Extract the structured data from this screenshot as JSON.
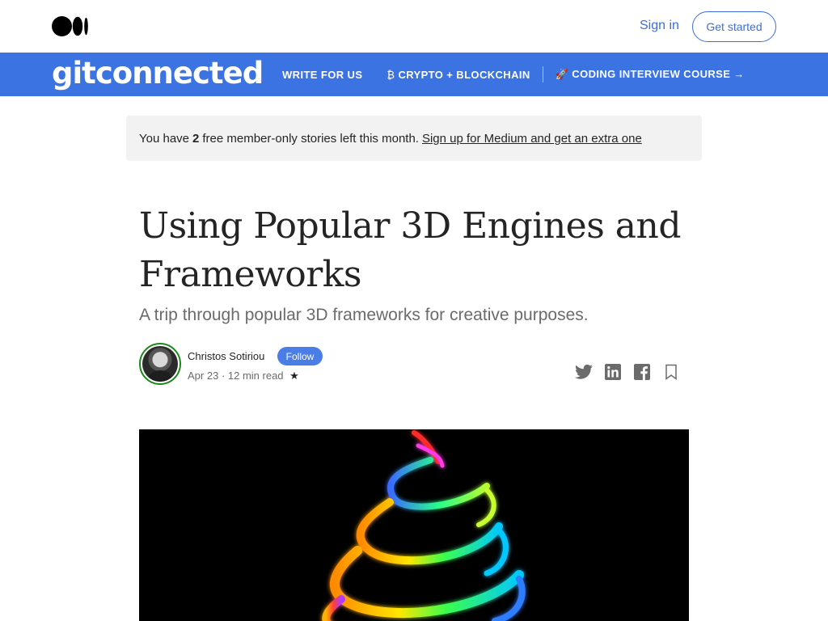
{
  "topbar": {
    "logo_icon": "medium-logo",
    "sign_in": "Sign in",
    "get_started": "Get started"
  },
  "publication": {
    "name": "gitconnected",
    "nav": [
      {
        "icon": "",
        "label": "WRITE FOR US"
      },
      {
        "icon": "₿",
        "label": "CRYPTO + BLOCKCHAIN"
      },
      {
        "icon": "🚀",
        "label": "CODING INTERVIEW COURSE →"
      }
    ],
    "accent": "#3b73e2"
  },
  "banner": {
    "prefix": "You have",
    "count": "2",
    "suffix": "free member-only stories left this month.",
    "signup": "Sign up for Medium and get an extra one"
  },
  "article": {
    "title": "Using Popular 3D Engines and Frameworks",
    "subtitle": "A trip through popular 3D frameworks for creative purposes.",
    "author": "Christos Sotiriou",
    "follow": "Follow",
    "date": "Apr 23",
    "read_time": "12 min read",
    "member_star": "★",
    "share_icons": [
      "twitter-icon",
      "linkedin-icon",
      "facebook-icon",
      "bookmark-icon"
    ]
  },
  "colors": {
    "link_blue": "#3d6ede",
    "follow_blue": "#4a7ee6",
    "avatar_ring": "#1a8917"
  }
}
